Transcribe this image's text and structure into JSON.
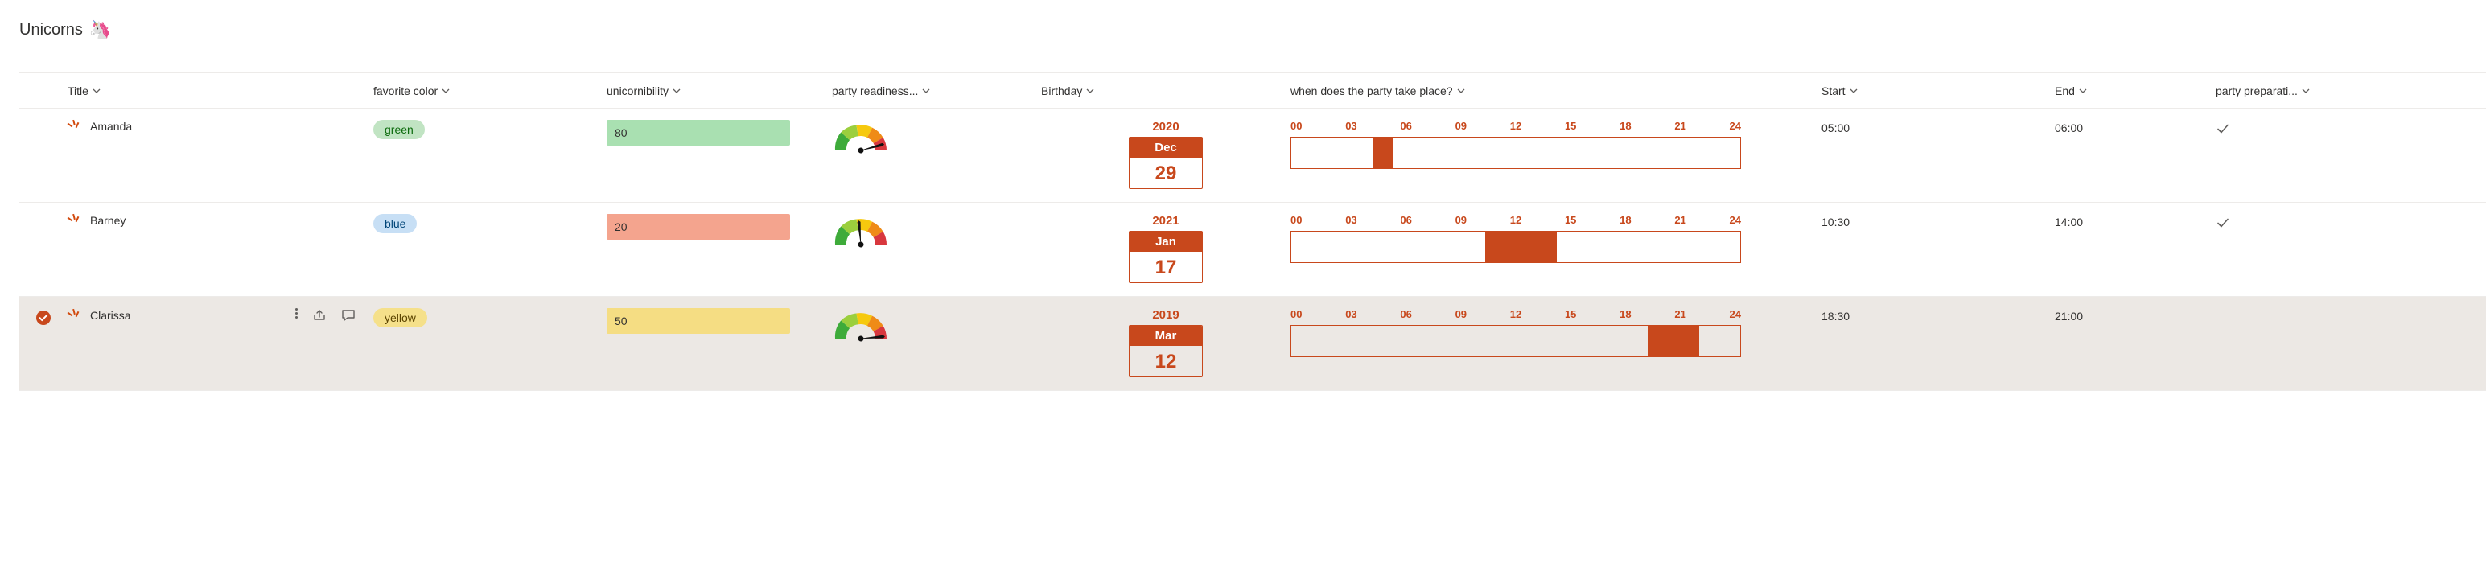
{
  "page": {
    "title": "Unicorns",
    "emoji": "🦄"
  },
  "columns": {
    "title": "Title",
    "favColor": "favorite color",
    "unicornibility": "unicornibility",
    "partyReadiness": "party readiness...",
    "birthday": "Birthday",
    "partyWhen": "when does the party take place?",
    "start": "Start",
    "end": "End",
    "partyPrep": "party preparati..."
  },
  "timeline": {
    "ticks": [
      "00",
      "03",
      "06",
      "09",
      "12",
      "15",
      "18",
      "21",
      "24"
    ]
  },
  "colors": {
    "accent": "#c8481c",
    "tags": {
      "green": {
        "bg": "#c1e4c3",
        "fg": "#0b6a0b"
      },
      "blue": {
        "bg": "#c7dff5",
        "fg": "#004578"
      },
      "yellow": {
        "bg": "#f5e08a",
        "fg": "#5c4400"
      }
    },
    "uniPills": {
      "high": "#a9e0b1",
      "low": "#f4a48e",
      "mid": "#f5dd83"
    }
  },
  "rows": [
    {
      "selected": false,
      "showActions": false,
      "title": "Amanda",
      "favColor": "green",
      "unicornibility": 80,
      "uniClass": "high",
      "gaugeNeedleDeg": 75,
      "birthday": {
        "year": "2020",
        "month": "Dec",
        "day": "29"
      },
      "timeline": {
        "startH": 5,
        "endH": 6
      },
      "start": "05:00",
      "end": "06:00",
      "prepDone": true
    },
    {
      "selected": false,
      "showActions": false,
      "title": "Barney",
      "favColor": "blue",
      "unicornibility": 20,
      "uniClass": "low",
      "gaugeNeedleDeg": -5,
      "birthday": {
        "year": "2021",
        "month": "Jan",
        "day": "17"
      },
      "timeline": {
        "startH": 10.5,
        "endH": 14
      },
      "start": "10:30",
      "end": "14:00",
      "prepDone": true
    },
    {
      "selected": true,
      "showActions": true,
      "title": "Clarissa",
      "favColor": "yellow",
      "unicornibility": 50,
      "uniClass": "mid",
      "gaugeNeedleDeg": 85,
      "birthday": {
        "year": "2019",
        "month": "Mar",
        "day": "12"
      },
      "timeline": {
        "startH": 18.5,
        "endH": 21
      },
      "start": "18:30",
      "end": "21:00",
      "prepDone": false
    }
  ]
}
